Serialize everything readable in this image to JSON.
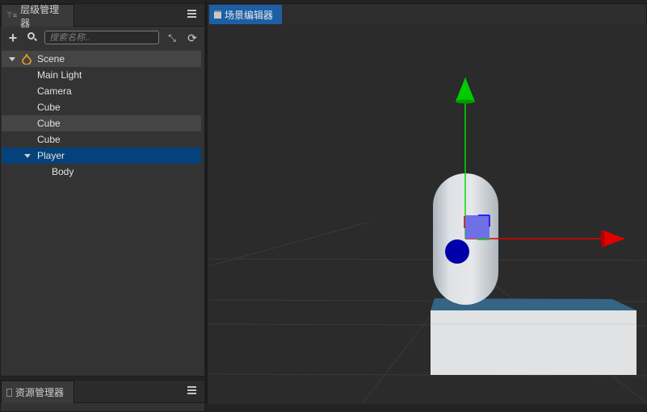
{
  "hierarchy_panel": {
    "tab_label": "层级管理器",
    "tab_icon": "hierarchy-icon",
    "menu_icon": "hamburger-menu-icon",
    "toolbar": {
      "add_icon": "plus-icon",
      "search_icon": "magnifier-icon",
      "search_placeholder": "搜索名称..",
      "search_value": "",
      "collapse_icon": "collapse-arrows-icon",
      "refresh_icon": "refresh-icon"
    },
    "tree": [
      {
        "label": "Scene",
        "depth": 0,
        "expanded": true,
        "icon": "scene-flame-icon",
        "state": "root"
      },
      {
        "label": "Main Light",
        "depth": 1,
        "state": "normal"
      },
      {
        "label": "Camera",
        "depth": 1,
        "state": "normal"
      },
      {
        "label": "Cube",
        "depth": 1,
        "state": "normal"
      },
      {
        "label": "Cube",
        "depth": 1,
        "state": "hover"
      },
      {
        "label": "Cube",
        "depth": 1,
        "state": "normal"
      },
      {
        "label": "Player",
        "depth": 1,
        "expanded": true,
        "state": "selected"
      },
      {
        "label": "Body",
        "depth": 2,
        "state": "normal"
      }
    ]
  },
  "assets_panel": {
    "tab_label": "资源管理器",
    "tab_icon": "assets-icon",
    "menu_icon": "hamburger-menu-icon"
  },
  "scene_editor": {
    "tab_label": "场景编辑器",
    "tab_icon": "scene-editor-icon",
    "accent_color": "#1d5fa6",
    "gizmo": {
      "x_axis_color": "#e00000",
      "y_axis_color": "#00cc00",
      "plane_handle_color": "#6f6fe6"
    },
    "objects": {
      "capsule_color": "#dfe2e6",
      "eye_color": "#0000aa",
      "ground_top_color": "#356485",
      "ground_side_color": "#e1e2e4"
    }
  }
}
